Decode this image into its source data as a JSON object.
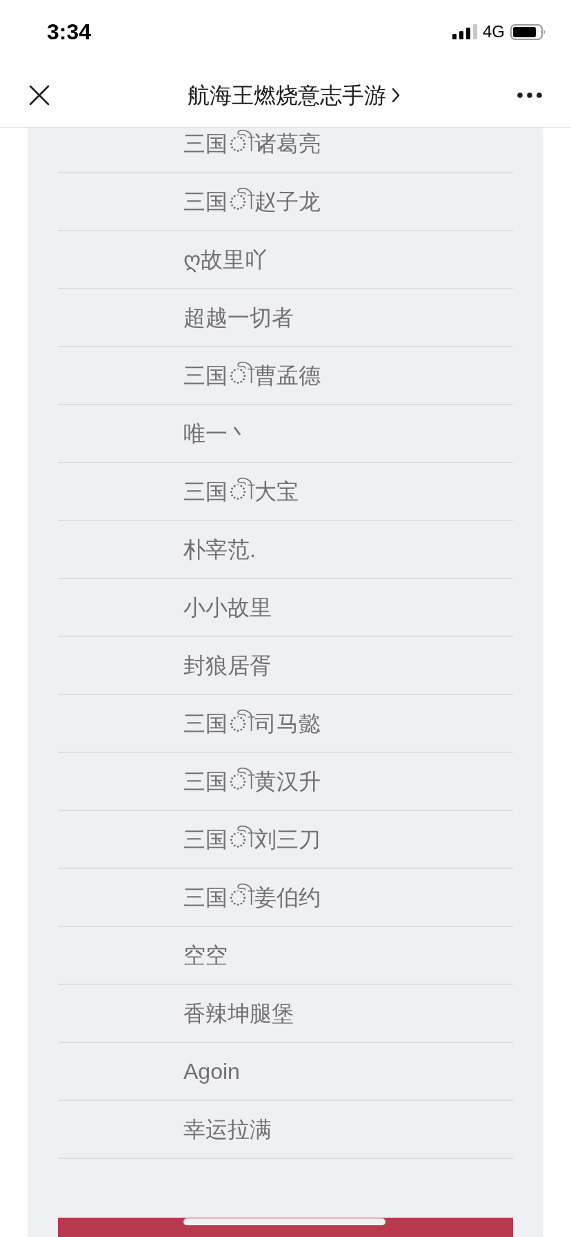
{
  "status_bar": {
    "time": "3:34",
    "network": "4G"
  },
  "nav_bar": {
    "title": "航海王燃烧意志手游"
  },
  "list": {
    "items": [
      "三国ী诸葛亮",
      "三国ী赵子龙",
      "ღ故里吖",
      "超越一切者",
      "三国ী曹孟德",
      "唯一丶",
      "三国ী大宝",
      "朴宰范.",
      "小小故里",
      "封狼居胥",
      "三国ী司马懿",
      "三国ী黄汉升",
      "三国ী刘三刀",
      "三国ী姜伯约",
      "空空",
      "香辣坤腿堡",
      "Agoin",
      "幸运拉满"
    ]
  }
}
